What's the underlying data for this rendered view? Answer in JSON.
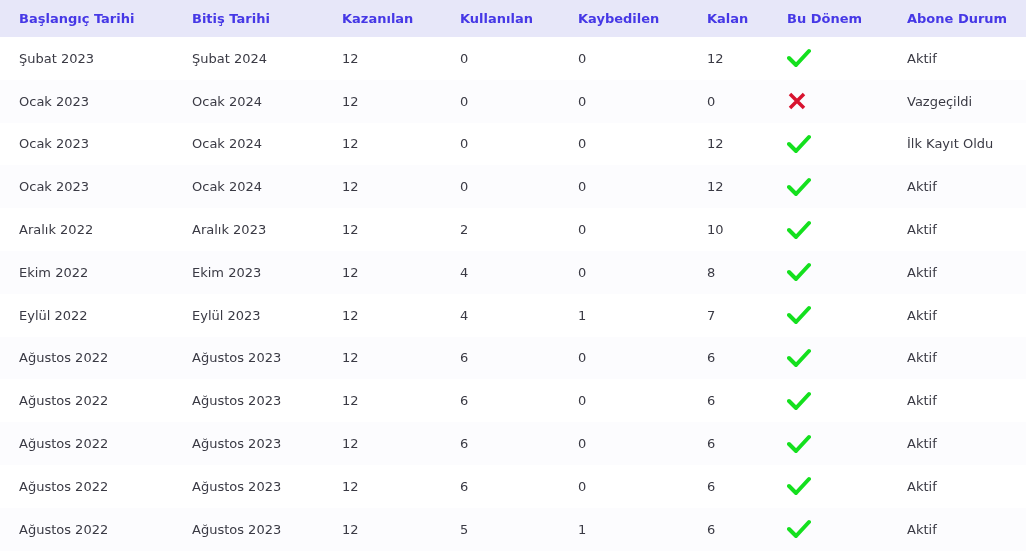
{
  "table": {
    "columns": [
      "Başlangıç Tarihi",
      "Bitiş Tarihi",
      "Kazanılan",
      "Kullanılan",
      "Kaybedilen",
      "Kalan",
      "Bu Dönem",
      "Abone Durum"
    ],
    "rows": [
      {
        "start": "Şubat 2023",
        "end": "Şubat 2024",
        "earned": "12",
        "used": "0",
        "lost": "0",
        "remaining": "12",
        "current": true,
        "status": "Aktif"
      },
      {
        "start": "Ocak 2023",
        "end": "Ocak 2024",
        "earned": "12",
        "used": "0",
        "lost": "0",
        "remaining": "0",
        "current": false,
        "status": "Vazgeçildi"
      },
      {
        "start": "Ocak 2023",
        "end": "Ocak 2024",
        "earned": "12",
        "used": "0",
        "lost": "0",
        "remaining": "12",
        "current": true,
        "status": "İlk Kayıt Oldu"
      },
      {
        "start": "Ocak 2023",
        "end": "Ocak 2024",
        "earned": "12",
        "used": "0",
        "lost": "0",
        "remaining": "12",
        "current": true,
        "status": "Aktif"
      },
      {
        "start": "Aralık 2022",
        "end": "Aralık 2023",
        "earned": "12",
        "used": "2",
        "lost": "0",
        "remaining": "10",
        "current": true,
        "status": "Aktif"
      },
      {
        "start": "Ekim 2022",
        "end": "Ekim 2023",
        "earned": "12",
        "used": "4",
        "lost": "0",
        "remaining": "8",
        "current": true,
        "status": "Aktif"
      },
      {
        "start": "Eylül 2022",
        "end": "Eylül 2023",
        "earned": "12",
        "used": "4",
        "lost": "1",
        "remaining": "7",
        "current": true,
        "status": "Aktif"
      },
      {
        "start": "Ağustos 2022",
        "end": "Ağustos 2023",
        "earned": "12",
        "used": "6",
        "lost": "0",
        "remaining": "6",
        "current": true,
        "status": "Aktif"
      },
      {
        "start": "Ağustos 2022",
        "end": "Ağustos 2023",
        "earned": "12",
        "used": "6",
        "lost": "0",
        "remaining": "6",
        "current": true,
        "status": "Aktif"
      },
      {
        "start": "Ağustos 2022",
        "end": "Ağustos 2023",
        "earned": "12",
        "used": "6",
        "lost": "0",
        "remaining": "6",
        "current": true,
        "status": "Aktif"
      },
      {
        "start": "Ağustos 2022",
        "end": "Ağustos 2023",
        "earned": "12",
        "used": "6",
        "lost": "0",
        "remaining": "6",
        "current": true,
        "status": "Aktif"
      },
      {
        "start": "Ağustos 2022",
        "end": "Ağustos 2023",
        "earned": "12",
        "used": "5",
        "lost": "1",
        "remaining": "6",
        "current": true,
        "status": "Aktif"
      }
    ]
  }
}
